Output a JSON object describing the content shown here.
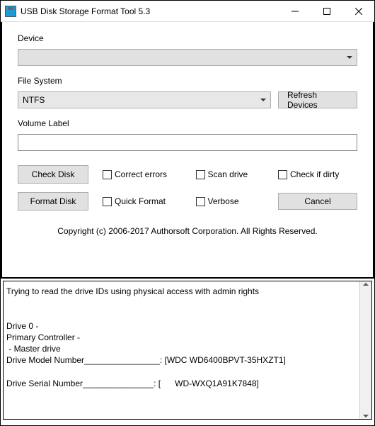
{
  "window": {
    "title": "USB Disk Storage Format Tool 5.3"
  },
  "labels": {
    "device": "Device",
    "file_system": "File System",
    "volume_label": "Volume Label"
  },
  "device": {
    "selected": ""
  },
  "file_system": {
    "selected": "NTFS"
  },
  "volume_label": {
    "value": ""
  },
  "buttons": {
    "refresh": "Refresh Devices",
    "check_disk": "Check Disk",
    "format_disk": "Format Disk",
    "cancel": "Cancel"
  },
  "checkboxes": {
    "correct_errors": "Correct errors",
    "scan_drive": "Scan drive",
    "check_if_dirty": "Check if dirty",
    "quick_format": "Quick Format",
    "verbose": "Verbose"
  },
  "copyright": "Copyright (c) 2006-2017 Authorsoft Corporation. All Rights Reserved.",
  "log": "Trying to read the drive IDs using physical access with admin rights\n\n\nDrive 0 -\nPrimary Controller -\n - Master drive\nDrive Model Number________________: [WDC WD6400BPVT-35HXZT1]\n\nDrive Serial Number_______________: [      WD-WXQ1A91K7848]"
}
